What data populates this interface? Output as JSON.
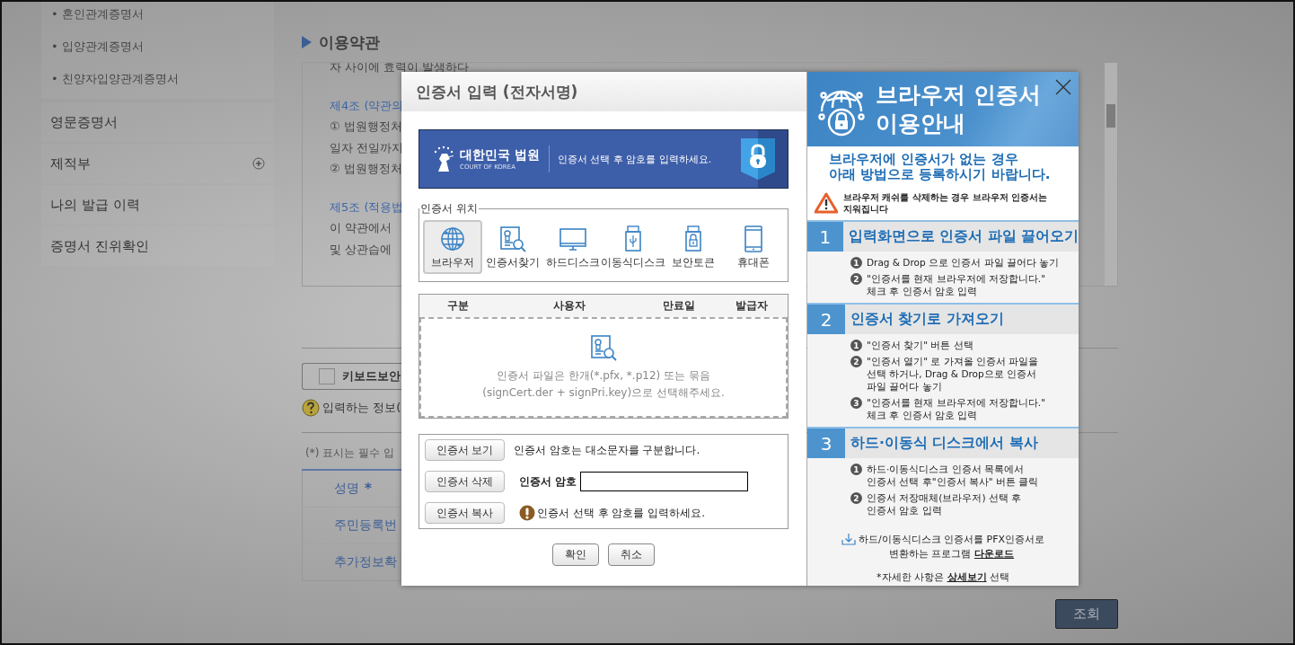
{
  "sidebar": {
    "sub_items": [
      "• 혼인관계증명서",
      "• 입양관계증명서",
      "• 친양자입양관계증명서"
    ],
    "items": [
      {
        "label": "영문증명서",
        "expandable": false
      },
      {
        "label": "제적부",
        "expandable": true
      },
      {
        "label": "나의 발급 이력",
        "expandable": false
      },
      {
        "label": "증명서 진위확인",
        "expandable": false
      }
    ]
  },
  "terms": {
    "title": "이용약관",
    "paragraphs": [
      {
        "lines": [
          {
            "kind": "text",
            "text": "자 사이에 효력이 발생하다"
          }
        ]
      },
      {
        "lines": [
          {
            "kind": "article",
            "text": "제4조 (약관의"
          },
          {
            "kind": "text",
            "text": "① 법원행정처"
          },
          {
            "kind": "text",
            "text": "일자 전일까지"
          },
          {
            "kind": "text",
            "text": "② 법원행정처"
          }
        ]
      },
      {
        "lines": [
          {
            "kind": "article",
            "text": "제5조 (적용법"
          },
          {
            "kind": "text",
            "text": "이 약관에서"
          },
          {
            "kind": "text",
            "text": "및 상관습에"
          }
        ]
      }
    ]
  },
  "keyboard_security": {
    "label": "키보드보안",
    "checked": false
  },
  "help_text": "입력하는 정보(",
  "required_note": "(*) 표시는 필수 입",
  "form_rows": [
    {
      "label": "성명",
      "required_mark": "*"
    },
    {
      "label": "주민등록번"
    },
    {
      "label": "추가정보확"
    }
  ],
  "search_button": "조회",
  "dialog": {
    "title": "인증서 입력 (전자서명)",
    "banner": {
      "org": "대한민국 법원",
      "org_en": "COURT OF KOREA",
      "message": "인증서 선택 후 암호를 입력하세요."
    },
    "location_legend": "인증서 위치",
    "locations": [
      {
        "label": "브라우저",
        "kind": "globe",
        "selected": true
      },
      {
        "label": "인증서찾기",
        "kind": "search",
        "selected": false
      },
      {
        "label": "하드디스크",
        "kind": "monitor",
        "selected": false
      },
      {
        "label": "이동식디스크",
        "kind": "usb",
        "selected": false
      },
      {
        "label": "보안토큰",
        "kind": "token",
        "selected": false
      },
      {
        "label": "휴대폰",
        "kind": "phone",
        "selected": false
      }
    ],
    "columns": [
      "구분",
      "사용자",
      "만료일",
      "발급자"
    ],
    "drop_hint": "인증서 파일은 한개(*.pfx, *.p12) 또는 묶음\n(signCert.der + signPri.key)으로 선택해주세요.",
    "cert_buttons": [
      "인증서 보기",
      "인증서 삭제",
      "인증서 복사"
    ],
    "case_note": "인증서 암호는 대소문자를 구분합니다.",
    "password_label": "인증서 암호",
    "password_hint": "인증서 선택 후 암호를 입력하세요.",
    "buttons": [
      "확인",
      "취소"
    ]
  },
  "guide": {
    "title": "브라우저 인증서\n이용안내",
    "subtitle": "브라우저에 인증서가 없는 경우\n아래 방법으로 등록하시기 바랍니다.",
    "warning": "브라우저 캐쉬를 삭제하는 경우 브라우저 인증서는\n지워집니다",
    "sections": [
      {
        "number": "1",
        "title": "입력화면으로 인증서 파일 끌어오기",
        "steps": [
          {
            "number": "1",
            "text": "Drag & Drop 으로 인증서 파일 끌어다 놓기"
          },
          {
            "number": "2",
            "text": "\"인증서를 현재 브라우저에 저장합니다.\"\n체크 후 인증서 암호 입력"
          }
        ]
      },
      {
        "number": "2",
        "title": "인증서 찾기로 가져오기",
        "steps": [
          {
            "number": "1",
            "text": "\"인증서 찾기\" 버튼 선택"
          },
          {
            "number": "2",
            "text": "\"인증서 열기\" 로 가져올 인증서 파일을\n선택 하거나, Drag & Drop으로 인증서\n파일 끌어다 놓기"
          },
          {
            "number": "3",
            "text": "\"인증서를 현재 브라우저에 저장합니다.\"\n체크 후 인증서 암호 입력"
          }
        ]
      },
      {
        "number": "3",
        "title": "하드·이동식 디스크에서 복사",
        "steps": [
          {
            "number": "1",
            "text": "하드·이동식디스크 인증서 목록에서\n인증서 선택 후\"인증서 복사\" 버튼 클릭"
          },
          {
            "number": "2",
            "text": "인증서 저장매체(브라우저) 선택 후\n인증서 암호 입력"
          }
        ]
      }
    ],
    "download_note": "하드/이동식디스크 인증서를 PFX인증서로\n변환하는 프로그램",
    "download_link": "다운로드",
    "detail_before": "*자세한 사항은",
    "detail_link": "상세보기",
    "detail_after": "선택"
  }
}
